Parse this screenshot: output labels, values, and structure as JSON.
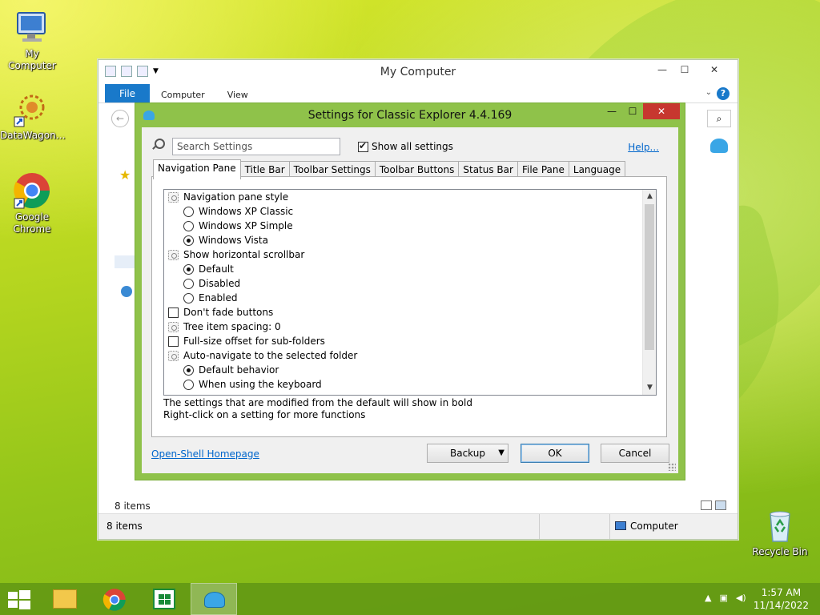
{
  "desktop": {
    "icons": [
      {
        "label": "My Computer"
      },
      {
        "label": "DataWagon…"
      },
      {
        "label": "Google Chrome"
      },
      {
        "label": "Recycle Bin"
      }
    ]
  },
  "explorer": {
    "title": "My Computer",
    "tabs": [
      "File",
      "Computer",
      "View"
    ],
    "help": "?",
    "items_count_inner": "8 items",
    "status_left": "8 items",
    "status_right": "Computer"
  },
  "dialog": {
    "title": "Settings for Classic Explorer 4.4.169",
    "search_placeholder": "Search Settings",
    "show_all_label": "Show all settings",
    "show_all_checked": true,
    "help_link": "Help...",
    "tabs": [
      "Navigation Pane",
      "Title Bar",
      "Toolbar Settings",
      "Toolbar Buttons",
      "Status Bar",
      "File Pane",
      "Language"
    ],
    "active_tab": "Navigation Pane",
    "settings": [
      {
        "type": "group",
        "label": "Navigation pane style"
      },
      {
        "type": "radio",
        "label": "Windows XP Classic",
        "checked": false
      },
      {
        "type": "radio",
        "label": "Windows XP Simple",
        "checked": false
      },
      {
        "type": "radio",
        "label": "Windows Vista",
        "checked": true
      },
      {
        "type": "group",
        "label": "Show horizontal scrollbar"
      },
      {
        "type": "radio",
        "label": "Default",
        "checked": true
      },
      {
        "type": "radio",
        "label": "Disabled",
        "checked": false
      },
      {
        "type": "radio",
        "label": "Enabled",
        "checked": false
      },
      {
        "type": "checkbox",
        "label": "Don't fade buttons",
        "checked": false
      },
      {
        "type": "group",
        "label": "Tree item spacing: 0"
      },
      {
        "type": "checkbox",
        "label": "Full-size offset for sub-folders",
        "checked": false
      },
      {
        "type": "group",
        "label": "Auto-navigate to the selected folder"
      },
      {
        "type": "radio",
        "label": "Default behavior",
        "checked": true
      },
      {
        "type": "radio",
        "label": "When using the keyboard",
        "checked": false
      }
    ],
    "note_line1": "The settings that are modified from the default will show in bold",
    "note_line2": "Right-click on a setting for more functions",
    "homepage_link": "Open-Shell Homepage",
    "buttons": {
      "backup": "Backup",
      "ok": "OK",
      "cancel": "Cancel"
    }
  },
  "taskbar": {
    "time": "1:57 AM",
    "date": "11/14/2022"
  }
}
